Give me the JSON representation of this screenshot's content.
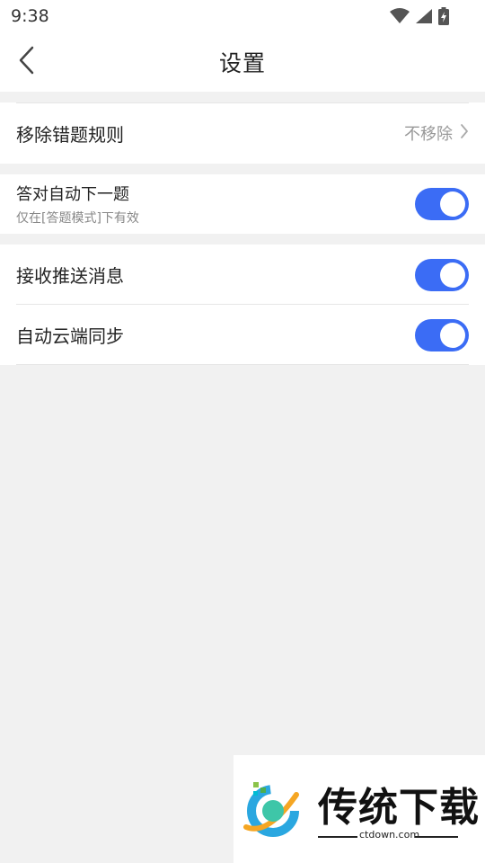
{
  "status_bar": {
    "time": "9:38"
  },
  "header": {
    "title": "设置"
  },
  "settings": {
    "remove_rule": {
      "label": "移除错题规则",
      "value": "不移除"
    },
    "auto_next": {
      "label": "答对自动下一题",
      "sub": "仅在[答题模式]下有效",
      "enabled": true
    },
    "push": {
      "label": "接收推送消息",
      "enabled": true
    },
    "cloud_sync": {
      "label": "自动云端同步",
      "enabled": true
    }
  },
  "watermark": {
    "brand": "传统下载",
    "site": "ctdown.com"
  },
  "colors": {
    "accent": "#3b6cf5",
    "background": "#f1f1f1"
  }
}
